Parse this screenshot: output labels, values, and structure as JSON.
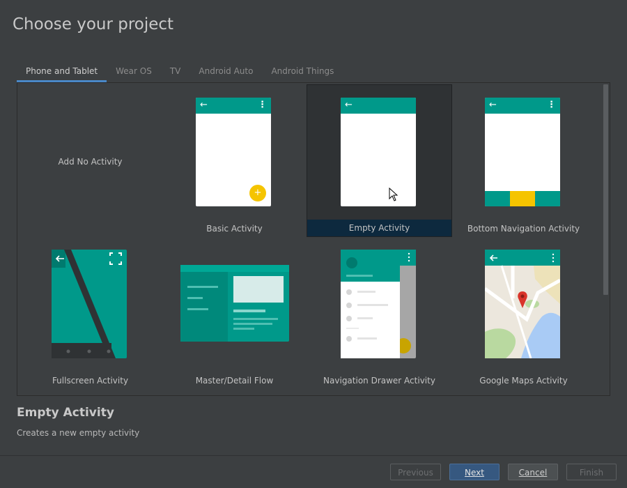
{
  "title": "Choose your project",
  "tabs": [
    {
      "label": "Phone and Tablet",
      "active": true
    },
    {
      "label": "Wear OS"
    },
    {
      "label": "TV"
    },
    {
      "label": "Android Auto"
    },
    {
      "label": "Android Things"
    }
  ],
  "templates": [
    {
      "label": "Add No Activity"
    },
    {
      "label": "Basic Activity",
      "fab_symbol": "+"
    },
    {
      "label": "Empty Activity",
      "selected": true
    },
    {
      "label": "Bottom Navigation Activity"
    },
    {
      "label": "Fullscreen Activity"
    },
    {
      "label": "Master/Detail Flow"
    },
    {
      "label": "Navigation Drawer Activity"
    },
    {
      "label": "Google Maps Activity"
    }
  ],
  "icons": {
    "back": "←",
    "more": "⋮"
  },
  "detail": {
    "title": "Empty Activity",
    "description": "Creates a new empty activity"
  },
  "buttons": {
    "previous": "Previous",
    "next": "Next",
    "cancel": "Cancel",
    "finish": "Finish"
  },
  "colors": {
    "accent": "#00998a",
    "fab": "#f5c400",
    "selection": "#0d293e",
    "primary_button": "#365880"
  }
}
